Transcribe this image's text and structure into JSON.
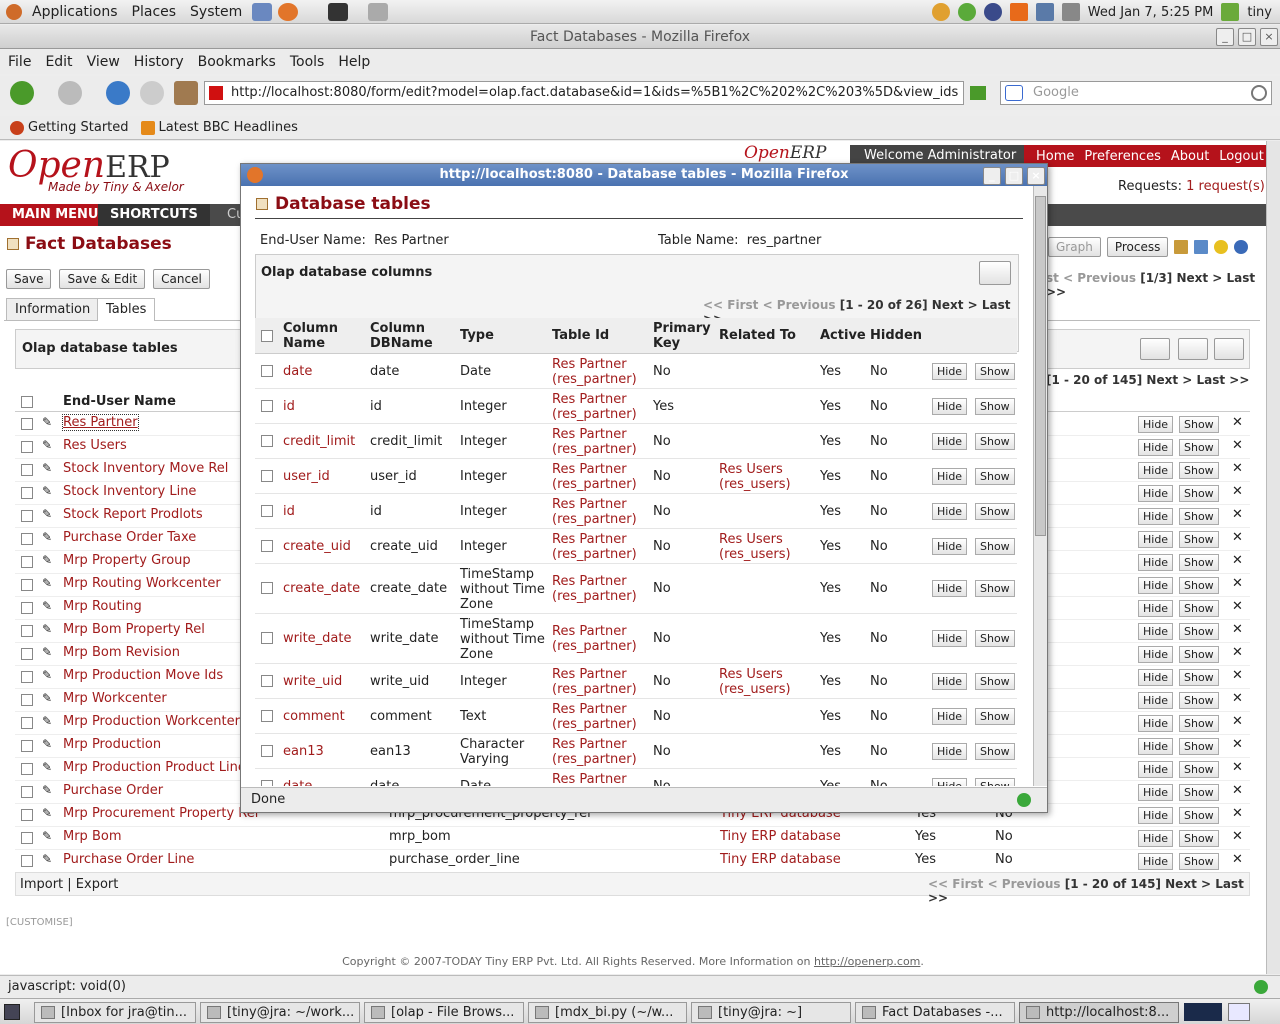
{
  "panel": {
    "menus": [
      "Applications",
      "Places",
      "System"
    ],
    "datetime": "Wed Jan  7,  5:25 PM",
    "user": "tiny"
  },
  "firefox": {
    "title": "Fact Databases - Mozilla Firefox",
    "menu": [
      "File",
      "Edit",
      "View",
      "History",
      "Bookmarks",
      "Tools",
      "Help"
    ],
    "url": "http://localhost:8080/form/edit?model=olap.fact.database&id=1&ids=%5B1%2C%202%2C%203%5D&view_ids",
    "search_placeholder": "Google",
    "bookmarks": [
      "Getting Started",
      "Latest BBC Headlines"
    ],
    "status": "javascript: void(0)"
  },
  "erp": {
    "logo_open": "Open",
    "logo_erp": "ERP",
    "logo_tag": "Made by Tiny & Axelor",
    "welcome": "Welcome Administrator",
    "top_links": [
      "Home",
      "Preferences",
      "About",
      "Logout"
    ],
    "requests_label": "Requests:",
    "requests_value": "1 request(s)",
    "main_menu": "MAIN MENU",
    "shortcuts": "SHORTCUTS",
    "shortcut_trunc": "Cu",
    "page_title": "Fact Databases",
    "buttons": {
      "save": "Save",
      "save_edit": "Save & Edit",
      "cancel": "Cancel"
    },
    "view_buttons": {
      "graph": "Graph",
      "process": "Process"
    },
    "record_pager": "< Previous",
    "record_pager_trunc": "st",
    "record_pager_count": "[1/3]",
    "record_pager_next": "Next > Last >>",
    "tabs": [
      "Information",
      "Tables"
    ],
    "tables_panel_title": "Olap database tables",
    "tables_pager_count": "[1 - 20 of 145]",
    "tables_pager_next": "Next > Last >>",
    "col_enduser": "End-User Name",
    "rows": [
      {
        "name": "Res Partner"
      },
      {
        "name": "Res Users"
      },
      {
        "name": "Stock Inventory Move Rel"
      },
      {
        "name": "Stock Inventory Line"
      },
      {
        "name": "Stock Report Prodlots"
      },
      {
        "name": "Purchase Order Taxe"
      },
      {
        "name": "Mrp Property Group"
      },
      {
        "name": "Mrp Routing Workcenter"
      },
      {
        "name": "Mrp Routing"
      },
      {
        "name": "Mrp Bom Property Rel"
      },
      {
        "name": "Mrp Bom Revision"
      },
      {
        "name": "Mrp Production Move Ids"
      },
      {
        "name": "Mrp Workcenter"
      },
      {
        "name": "Mrp Production Workcenter L"
      },
      {
        "name": "Mrp Production"
      },
      {
        "name": "Mrp Production Product Line"
      },
      {
        "name": "Purchase Order"
      },
      {
        "name": "Mrp Procurement Property Rel",
        "db": "mrp_procurement_property_rel",
        "database": "Tiny ERP database",
        "active": "Yes",
        "hidden": "No"
      },
      {
        "name": "Mrp Bom",
        "db": "mrp_bom",
        "database": "Tiny ERP database",
        "active": "Yes",
        "hidden": "No"
      },
      {
        "name": "Purchase Order Line",
        "db": "purchase_order_line",
        "database": "Tiny ERP database",
        "active": "Yes",
        "hidden": "No"
      }
    ],
    "hide": "Hide",
    "show": "Show",
    "import_export": "Import | Export",
    "bottom_pager_prev": "<< First < Previous",
    "bottom_pager_count": "[1 - 20 of 145]",
    "bottom_pager_next": "Next > Last >>",
    "customise": "[CUSTOMISE]",
    "copyright": "Copyright © 2007-TODAY Tiny ERP Pvt. Ltd. All Rights Reserved. More Information on",
    "copyright_link": "http://openerp.com",
    "copyright_end": "."
  },
  "popup": {
    "title": "http://localhost:8080 - Database tables - Mozilla Firefox",
    "heading": "Database tables",
    "enduser_label": "End-User Name:",
    "enduser_value": "Res Partner",
    "table_label": "Table Name:",
    "table_value": "res_partner",
    "panel_title": "Olap database columns",
    "pager_prev": "<< First < Previous",
    "pager_count": "[1 - 20 of 26]",
    "pager_next": "Next > Last >>",
    "headers": {
      "col_name_1": "Column",
      "col_name_2": "Name",
      "col_db_1": "Column",
      "col_db_2": "DBName",
      "type": "Type",
      "table_id": "Table Id",
      "pk_1": "Primary",
      "pk_2": "Key",
      "related": "Related To",
      "active": "Active",
      "hidden": "Hidden"
    },
    "rows": [
      {
        "name": "date",
        "db": "date",
        "type": [
          "Date"
        ],
        "table": [
          "Res Partner",
          "(res_partner)"
        ],
        "pk": "No",
        "related": [],
        "active": "Yes",
        "hidden": "No"
      },
      {
        "name": "id",
        "db": "id",
        "type": [
          "Integer"
        ],
        "table": [
          "Res Partner",
          "(res_partner)"
        ],
        "pk": "Yes",
        "related": [],
        "active": "Yes",
        "hidden": "No"
      },
      {
        "name": "credit_limit",
        "db": "credit_limit",
        "type": [
          "Integer"
        ],
        "table": [
          "Res Partner",
          "(res_partner)"
        ],
        "pk": "No",
        "related": [],
        "active": "Yes",
        "hidden": "No"
      },
      {
        "name": "user_id",
        "db": "user_id",
        "type": [
          "Integer"
        ],
        "table": [
          "Res Partner",
          "(res_partner)"
        ],
        "pk": "No",
        "related": [
          "Res Users",
          "(res_users)"
        ],
        "active": "Yes",
        "hidden": "No"
      },
      {
        "name": "id",
        "db": "id",
        "type": [
          "Integer"
        ],
        "table": [
          "Res Partner",
          "(res_partner)"
        ],
        "pk": "No",
        "related": [],
        "active": "Yes",
        "hidden": "No"
      },
      {
        "name": "create_uid",
        "db": "create_uid",
        "type": [
          "Integer"
        ],
        "table": [
          "Res Partner",
          "(res_partner)"
        ],
        "pk": "No",
        "related": [
          "Res Users",
          "(res_users)"
        ],
        "active": "Yes",
        "hidden": "No"
      },
      {
        "name": "create_date",
        "db": "create_date",
        "type": [
          "TimeStamp",
          "without Time",
          "Zone"
        ],
        "table": [
          "Res Partner",
          "(res_partner)"
        ],
        "pk": "No",
        "related": [],
        "active": "Yes",
        "hidden": "No"
      },
      {
        "name": "write_date",
        "db": "write_date",
        "type": [
          "TimeStamp",
          "without Time",
          "Zone"
        ],
        "table": [
          "Res Partner",
          "(res_partner)"
        ],
        "pk": "No",
        "related": [],
        "active": "Yes",
        "hidden": "No"
      },
      {
        "name": "write_uid",
        "db": "write_uid",
        "type": [
          "Integer"
        ],
        "table": [
          "Res Partner",
          "(res_partner)"
        ],
        "pk": "No",
        "related": [
          "Res Users",
          "(res_users)"
        ],
        "active": "Yes",
        "hidden": "No"
      },
      {
        "name": "comment",
        "db": "comment",
        "type": [
          "Text"
        ],
        "table": [
          "Res Partner",
          "(res_partner)"
        ],
        "pk": "No",
        "related": [],
        "active": "Yes",
        "hidden": "No"
      },
      {
        "name": "ean13",
        "db": "ean13",
        "type": [
          "Character",
          "Varying"
        ],
        "table": [
          "Res Partner",
          "(res_partner)"
        ],
        "pk": "No",
        "related": [],
        "active": "Yes",
        "hidden": "No"
      },
      {
        "name": "date",
        "db": "date",
        "type": [
          "Date"
        ],
        "table": [
          "Res Partner"
        ],
        "pk": "No",
        "related": [],
        "active": "Yes",
        "hidden": "No"
      }
    ],
    "status": "Done"
  },
  "taskbar": [
    {
      "label": "[Inbox for jra@tin...",
      "active": false
    },
    {
      "label": "[tiny@jra: ~/work...",
      "active": false
    },
    {
      "label": "[olap - File Brows...",
      "active": false
    },
    {
      "label": "[mdx_bi.py (~/w...",
      "active": false
    },
    {
      "label": "[tiny@jra: ~]",
      "active": false
    },
    {
      "label": "Fact Databases -...",
      "active": false
    },
    {
      "label": "http://localhost:8...",
      "active": true
    }
  ],
  "colors": {
    "brand_red": "#b5121b",
    "link_red": "#a11c1c",
    "dark_bar": "#4a4a4a",
    "popup_title": "#4a72b0"
  }
}
